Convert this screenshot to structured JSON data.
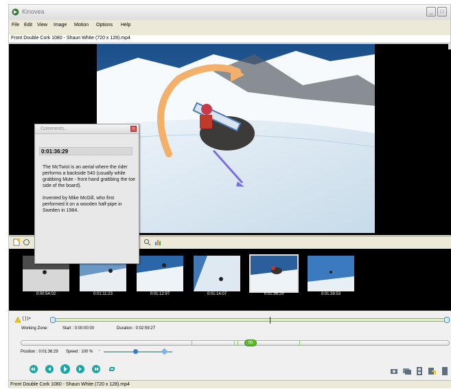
{
  "app": {
    "title": "Kinovea"
  },
  "menu": [
    "File",
    "Edit",
    "View",
    "Image",
    "Motion",
    "Options",
    "Help"
  ],
  "file": {
    "name": "Front Double Cork 1080 - Shaun White (720 x 128).mp4"
  },
  "comments": {
    "title": "Comments...",
    "timestamp": "0:01:36:29",
    "paragraph1": "The McTwist is an aerial where the rider performs a backside 540 (usually while grabbing Mute - front hand grabbing the toe side of the board).",
    "paragraph2": "Invented by Mike McGill, who first performed it on a wooden half-pipe in Sweden in 1984."
  },
  "thumbnails": [
    {
      "time": "0:00:54:02",
      "selected": false
    },
    {
      "time": "0:01:11:23",
      "selected": false
    },
    {
      "time": "0:01:12:97",
      "selected": false
    },
    {
      "time": "0:01:14:07",
      "selected": false
    },
    {
      "time": "0:01:36:29",
      "selected": true
    },
    {
      "time": "0:01:39:53",
      "selected": false
    }
  ],
  "working_zone": {
    "label": "Working Zone:",
    "start": "Start : 0:00:00:00",
    "duration": "Duration : 0:02:59:27",
    "bracket_symbols": "[ ] |>"
  },
  "position": {
    "text": "Position : 0:01:36:29",
    "speed": "Speed : 100 %",
    "marker": "00"
  },
  "status": {
    "text": "Front Double Cork 1080 - Shaun White (720 x 128).mp4"
  },
  "colors": {
    "accent_green": "#5cb82e",
    "arrow_orange": "#f2b06a",
    "arrow_purple": "#7b6fe0",
    "playback_teal": "#1aa6a6"
  }
}
